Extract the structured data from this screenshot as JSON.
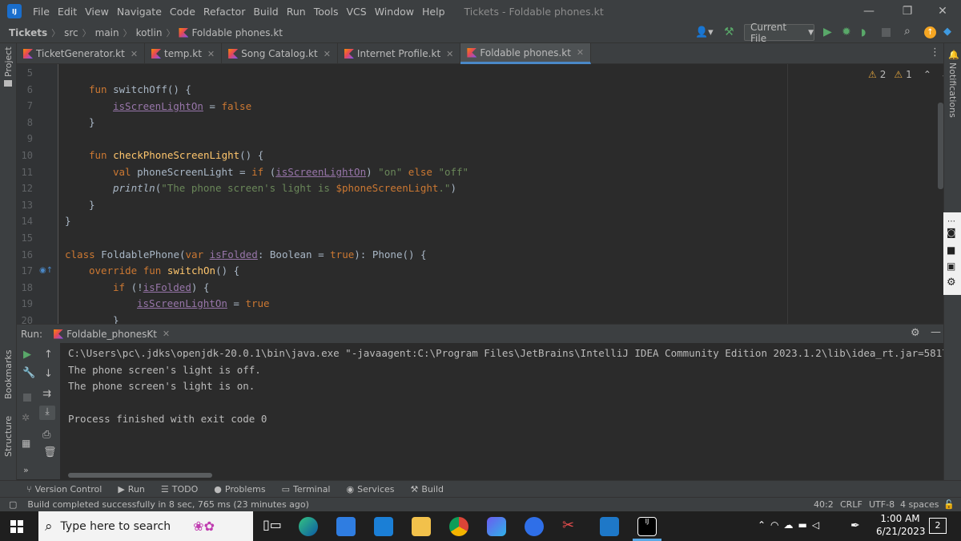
{
  "menubar": {
    "logo": "IJ",
    "items": [
      "File",
      "Edit",
      "View",
      "Navigate",
      "Code",
      "Refactor",
      "Build",
      "Run",
      "Tools",
      "VCS",
      "Window",
      "Help"
    ],
    "window_title": "Tickets - Foldable phones.kt"
  },
  "breadcrumb": {
    "items": [
      "Tickets",
      "src",
      "main",
      "kotlin",
      "Foldable phones.kt"
    ]
  },
  "toolbar": {
    "run_config": "Current File"
  },
  "left_strip": {
    "labels": [
      "Project",
      "Bookmarks",
      "Structure"
    ]
  },
  "right_strip": {
    "labels": [
      "Notifications"
    ]
  },
  "tabs": [
    {
      "label": "TicketGenerator.kt"
    },
    {
      "label": "temp.kt"
    },
    {
      "label": "Song Catalog.kt"
    },
    {
      "label": "Internet Profile.kt"
    },
    {
      "label": "Foldable phones.kt",
      "active": true
    }
  ],
  "editor": {
    "inspections": {
      "warnings": "2",
      "weak_warnings": "1"
    },
    "line_numbers": [
      "5",
      "6",
      "7",
      "8",
      "9",
      "10",
      "11",
      "12",
      "13",
      "14",
      "15",
      "16",
      "17",
      "18",
      "19",
      "20"
    ],
    "lines": {
      "l6_fn": "fun ",
      "l6_name": "switchOff",
      "l6_rest": "() {",
      "l7_prop": "isScreenLightOn",
      "l7_op": " = ",
      "l7_val": "false",
      "l8": "}",
      "l10_fn": "fun ",
      "l10_name": "checkPhoneScreenLight",
      "l10_rest": "() {",
      "l11_val": "val ",
      "l11_a": "phoneScreenLight = ",
      "l11_if": "if ",
      "l11_b": "(",
      "l11_prop": "isScreenLightOn",
      "l11_c": ") ",
      "l11_on": "\"on\"",
      "l11_else": " else ",
      "l11_off": "\"off\"",
      "l12_fn": "println",
      "l12_a": "(",
      "l12_s1": "\"The phone screen's light is ",
      "l12_tmpl": "$phoneScreenLight",
      "l12_s2": ".\"",
      "l12_b": ")",
      "l13": "}",
      "l14": "}",
      "l16_class": "class ",
      "l16_name": "FoldablePhone(",
      "l16_var": "var ",
      "l16_prop": "isFolded",
      "l16_type": ": Boolean = ",
      "l16_true": "true",
      "l16_rest": "): Phone() {",
      "l17_kw": "override fun ",
      "l17_name": "switchOn",
      "l17_rest": "() {",
      "l18_if": "if ",
      "l18_a": "(!",
      "l18_prop": "isFolded",
      "l18_b": ") {",
      "l19_prop": "isScreenLightOn",
      "l19_op": " = ",
      "l19_val": "true",
      "l20": "}"
    }
  },
  "run_panel": {
    "label": "Run:",
    "tab": "Foldable_phonesKt",
    "console": [
      "C:\\Users\\pc\\.jdks\\openjdk-20.0.1\\bin\\java.exe \"-javaagent:C:\\Program Files\\JetBrains\\IntelliJ IDEA Community Edition 2023.1.2\\lib\\idea_rt.jar=5817",
      "The phone screen's light is off.",
      "The phone screen's light is on.",
      "",
      "Process finished with exit code 0"
    ]
  },
  "bottom_tools": [
    "Version Control",
    "Run",
    "TODO",
    "Problems",
    "Terminal",
    "Services",
    "Build"
  ],
  "status": {
    "message": "Build completed successfully in 8 sec, 765 ms (23 minutes ago)",
    "position": "40:2",
    "line_sep": "CRLF",
    "encoding": "UTF-8",
    "indent": "4 spaces"
  },
  "taskbar": {
    "search_placeholder": "Type here to search",
    "time": "1:00 AM",
    "date": "6/21/2023",
    "notifications": "2"
  },
  "colors": {
    "accent": "#4a88c7",
    "keyword": "#cc7832",
    "function": "#ffc66d",
    "property": "#9876aa",
    "string": "#6a8759",
    "run_green": "#59a869"
  }
}
